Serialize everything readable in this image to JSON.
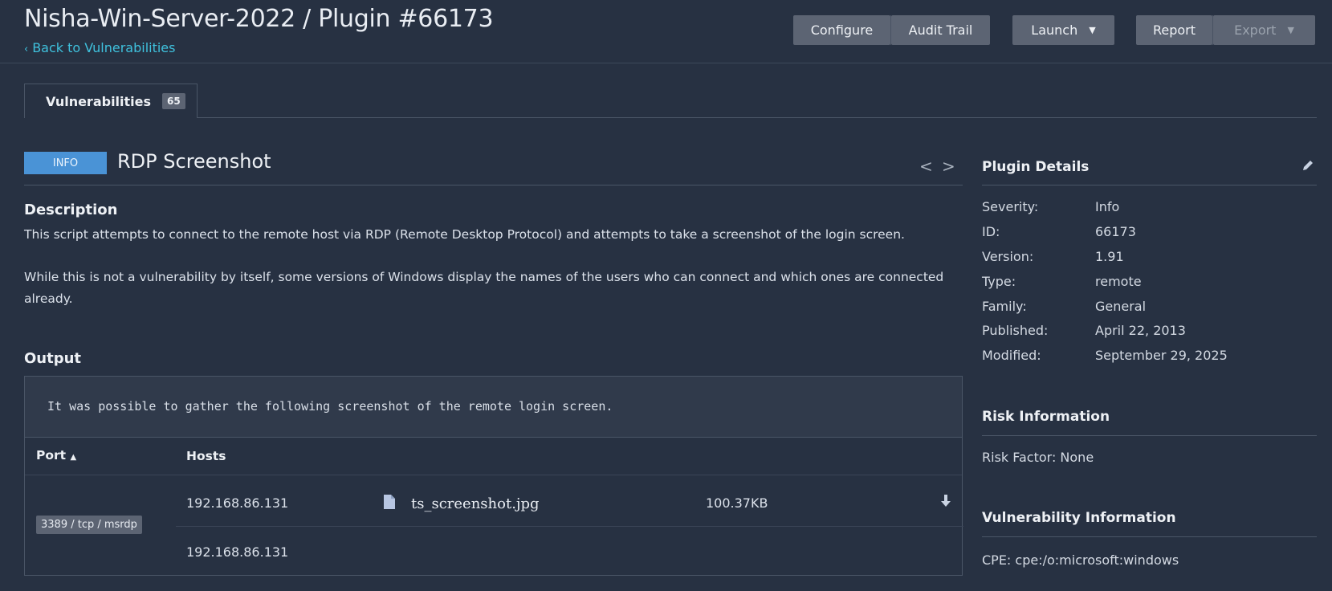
{
  "header": {
    "title": "Nisha-Win-Server-2022 / Plugin #66173",
    "back_link": "Back to Vulnerabilities",
    "buttons": {
      "configure": "Configure",
      "audit_trail": "Audit Trail",
      "launch": "Launch",
      "report": "Report",
      "export": "Export"
    }
  },
  "tabs": [
    {
      "label": "Vulnerabilities",
      "count": "65"
    }
  ],
  "vulnerability": {
    "severity_badge": "INFO",
    "title": "RDP Screenshot",
    "description_heading": "Description",
    "description_p1": "This script attempts to connect to the remote host via RDP (Remote Desktop Protocol) and attempts to take a screenshot of the login screen.",
    "description_p2": "While this is not a vulnerability by itself, some versions of Windows display the names of the users who can connect and which ones are connected already.",
    "output_heading": "Output",
    "output_text": "It was possible to gather the following screenshot of the remote login screen.",
    "table": {
      "col_port": "Port",
      "col_port_sort": "▲",
      "col_hosts": "Hosts",
      "port": "3389 / tcp / msrdp",
      "rows": [
        {
          "host": "192.168.86.131",
          "file": "ts_screenshot.jpg",
          "size": "100.37KB"
        },
        {
          "host": "192.168.86.131"
        }
      ]
    }
  },
  "sidebar": {
    "plugin_details_heading": "Plugin Details",
    "details": [
      {
        "key": "Severity:",
        "value": "Info"
      },
      {
        "key": "ID:",
        "value": "66173"
      },
      {
        "key": "Version:",
        "value": "1.91"
      },
      {
        "key": "Type:",
        "value": "remote"
      },
      {
        "key": "Family:",
        "value": "General"
      },
      {
        "key": "Published:",
        "value": "April 22, 2013"
      },
      {
        "key": "Modified:",
        "value": "September 29, 2025"
      }
    ],
    "risk_heading": "Risk Information",
    "risk_factor": "Risk Factor: None",
    "vuln_info_heading": "Vulnerability Information",
    "cpe": "CPE: cpe:/o:microsoft:windows"
  },
  "colors": {
    "background": "#273142",
    "link": "#3fc1dd",
    "info_badge": "#4a93d6",
    "button": "#5c6473"
  },
  "icons": [
    "chevron-left-icon",
    "caret-down-icon",
    "arrow-prev-icon",
    "arrow-next-icon",
    "edit-pencil-icon",
    "file-icon",
    "download-icon",
    "sort-asc-icon"
  ]
}
